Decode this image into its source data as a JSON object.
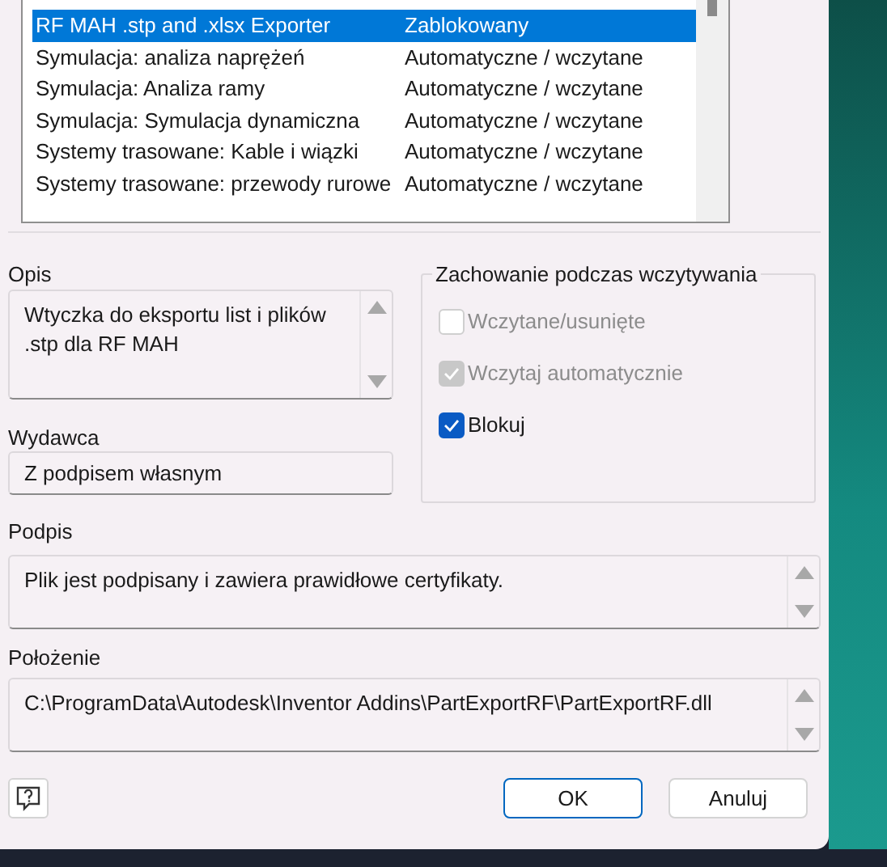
{
  "addins": {
    "rows": [
      {
        "name": "RF MAH .stp and .xlsx Exporter",
        "status": "Zablokowany",
        "selected": true
      },
      {
        "name": "Symulacja: analiza naprężeń",
        "status": "Automatyczne / wczytane",
        "selected": false
      },
      {
        "name": "Symulacja: Analiza ramy",
        "status": "Automatyczne / wczytane",
        "selected": false
      },
      {
        "name": "Symulacja: Symulacja dynamiczna",
        "status": "Automatyczne / wczytane",
        "selected": false
      },
      {
        "name": "Systemy trasowane: Kable i wiązki",
        "status": "Automatyczne / wczytane",
        "selected": false
      },
      {
        "name": "Systemy trasowane: przewody rurowe",
        "status": "Automatyczne / wczytane",
        "selected": false
      }
    ]
  },
  "description": {
    "label": "Opis",
    "value": "Wtyczka do eksportu list i plików\n.stp dla RF MAH"
  },
  "publisher": {
    "label": "Wydawca",
    "value": "Z podpisem własnym"
  },
  "load_behavior": {
    "title": "Zachowanie podczas wczytywania",
    "options": [
      {
        "label": "Wczytane/usunięte",
        "checked": false,
        "disabled": true
      },
      {
        "label": "Wczytaj automatycznie",
        "checked": true,
        "disabled": true
      },
      {
        "label": "Blokuj",
        "checked": true,
        "disabled": false
      }
    ]
  },
  "signature": {
    "label": "Podpis",
    "value": "Plik jest podpisany i zawiera prawidłowe certyfikaty."
  },
  "location": {
    "label": "Położenie",
    "value": "C:\\ProgramData\\Autodesk\\Inventor Addins\\PartExportRF\\PartExportRF.dll"
  },
  "buttons": {
    "ok": "OK",
    "cancel": "Anuluj"
  }
}
